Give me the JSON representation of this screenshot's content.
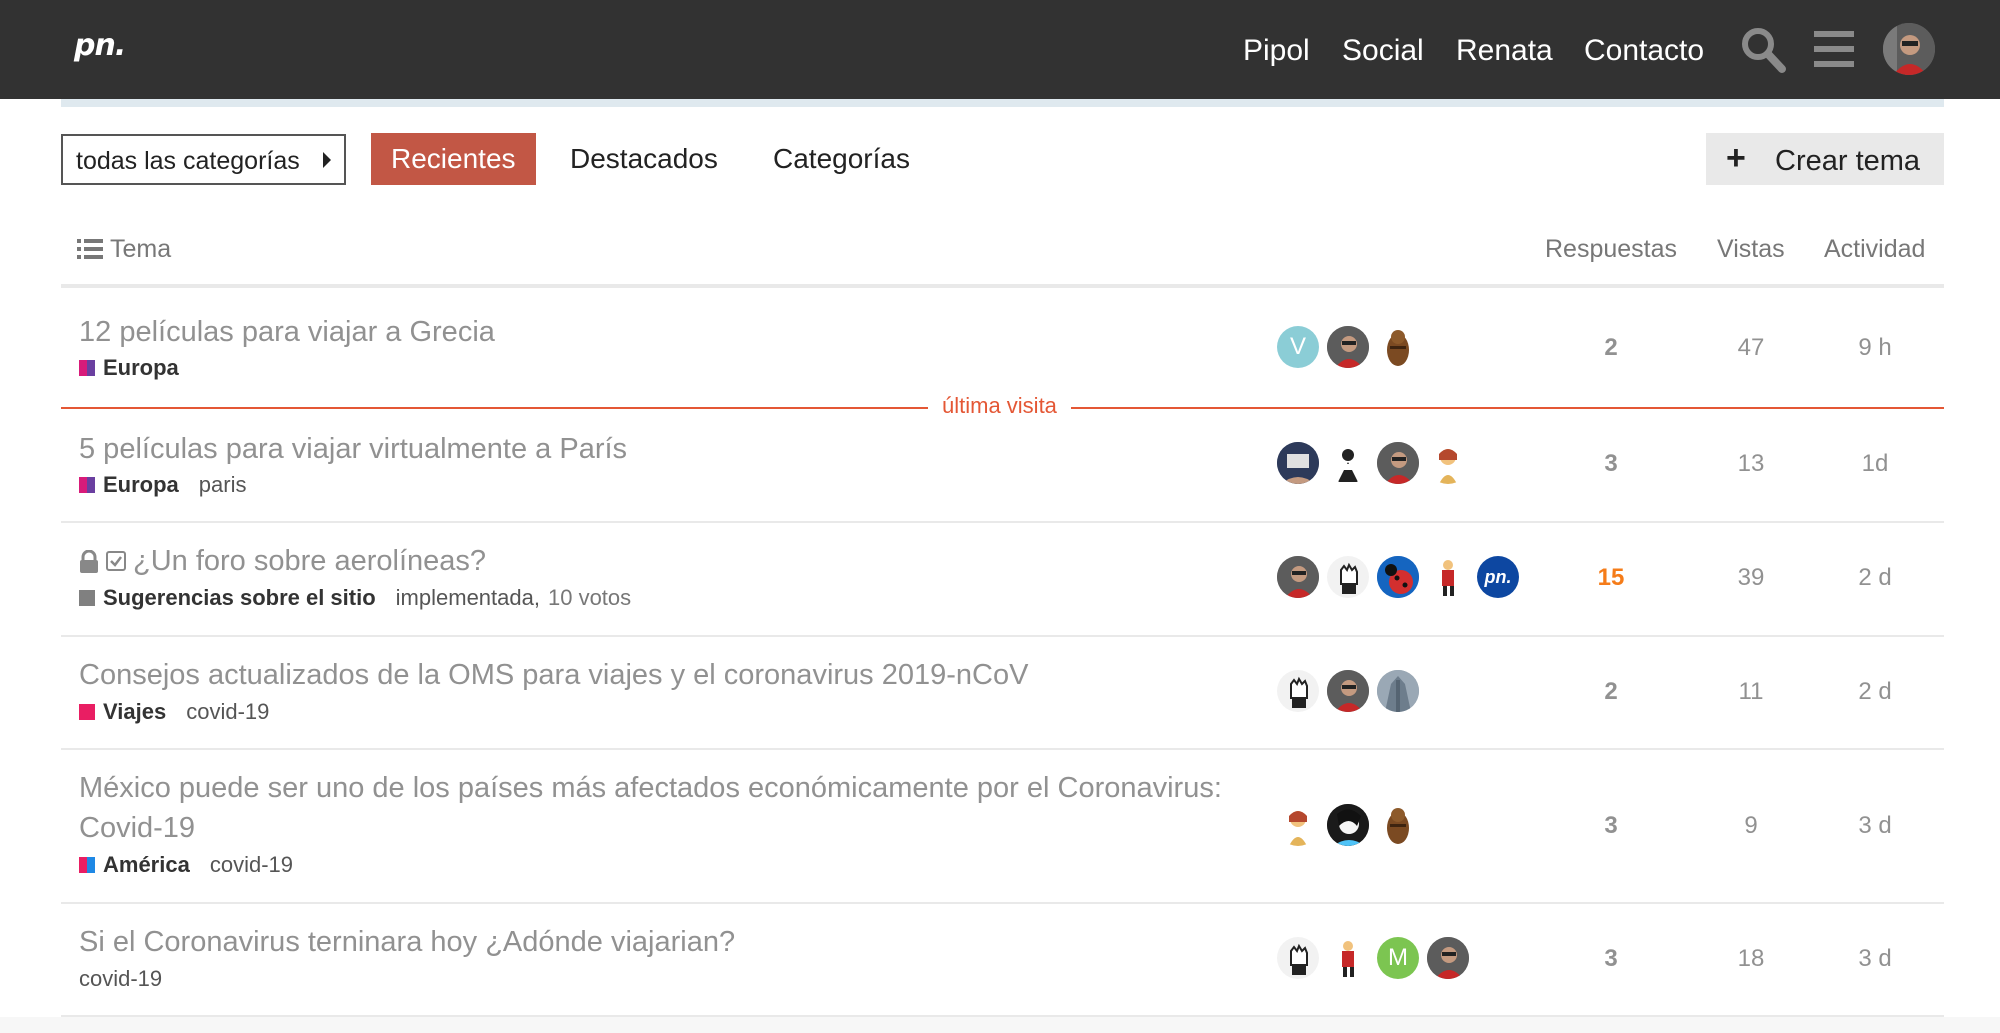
{
  "header": {
    "logo": "pn.",
    "nav": [
      "Pipol",
      "Social",
      "Renata",
      "Contacto"
    ],
    "icons": [
      "search-icon",
      "hamburger-menu-icon",
      "user-avatar"
    ]
  },
  "controls": {
    "category_dropdown": "todas las categorías",
    "tabs": [
      "Recientes",
      "Destacados",
      "Categorías"
    ],
    "active_tab": "Recientes",
    "create_button": "Crear tema"
  },
  "table": {
    "headers": {
      "topic": "Tema",
      "replies": "Respuestas",
      "views": "Vistas",
      "activity": "Actividad"
    },
    "last_visit_label": "última visita",
    "topics": [
      {
        "title": "12 películas para viajar a Grecia",
        "category": "Europa",
        "category_colors": [
          "#d81b7a",
          "#6a3fa0"
        ],
        "tags": [],
        "replies": "2",
        "views": "47",
        "activity": "9 h",
        "posters": [
          "letter-V",
          "photo-man-red",
          "chewbacca"
        ]
      },
      {
        "title": "5 películas para viajar virtualmente a París",
        "category": "Europa",
        "category_colors": [
          "#d81b7a",
          "#6a3fa0"
        ],
        "tags": [
          "paris"
        ],
        "replies": "3",
        "views": "13",
        "activity": "1d",
        "posters": [
          "photo-device",
          "cartoon-figure",
          "photo-man-red",
          "cartoon-woman"
        ]
      },
      {
        "title": "¿Un foro sobre aerolíneas?",
        "category": "Sugerencias sobre el sitio",
        "category_colors": [
          "#808080",
          "#808080"
        ],
        "tags": [
          "implementada"
        ],
        "votes": "10 votos",
        "locked": true,
        "replies": "15",
        "views": "39",
        "activity": "2 d",
        "posters": [
          "photo-man-red",
          "fist-icon",
          "ladybug",
          "red-figure",
          "pn-logo"
        ]
      },
      {
        "title": "Consejos actualizados de la OMS para viajes y el coronavirus 2019-nCoV",
        "category": "Viajes",
        "category_colors": [
          "#e91e63",
          "#e91e63"
        ],
        "tags": [
          "covid-19"
        ],
        "replies": "2",
        "views": "11",
        "activity": "2 d",
        "posters": [
          "fist-icon",
          "photo-man-red",
          "photo-building"
        ]
      },
      {
        "title": "México puede ser uno de los países más afectados económicamente por el Coronavirus:",
        "title_line2": "Covid-19",
        "category": "América",
        "category_colors": [
          "#e91e63",
          "#1e88e5"
        ],
        "tags": [
          "covid-19"
        ],
        "replies": "3",
        "views": "9",
        "activity": "3 d",
        "posters": [
          "cartoon-woman",
          "anime-girl",
          "chewbacca"
        ]
      },
      {
        "title": "Si el Coronavirus terninara hoy ¿Adónde viajarian?",
        "category": "",
        "tags": [
          "covid-19"
        ],
        "replies": "3",
        "views": "18",
        "activity": "3 d",
        "posters": [
          "fist-icon",
          "red-figure",
          "letter-M",
          "photo-man-red"
        ]
      }
    ]
  },
  "colors": {
    "header_bg": "#323232",
    "accent": "#c25745",
    "last_visit": "#e45735",
    "hot_replies": "#f57c19"
  }
}
